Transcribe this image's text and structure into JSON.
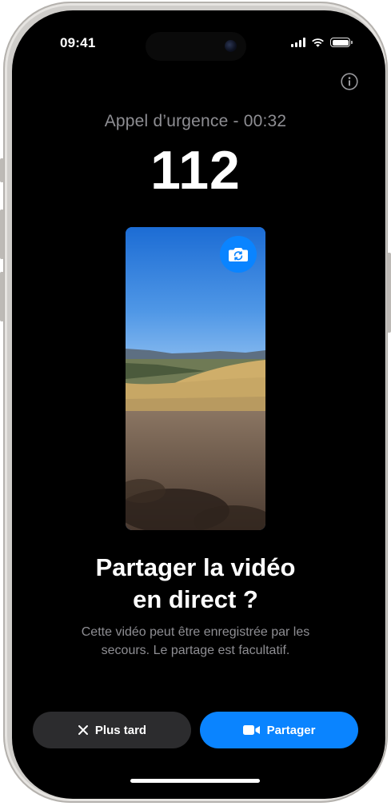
{
  "status_bar": {
    "time": "09:41",
    "icons": [
      "cellular-signal-icon",
      "wifi-icon",
      "battery-icon"
    ],
    "battery_level": 1.0
  },
  "call": {
    "status": "Appel d’urgence - 00:32",
    "number": "112"
  },
  "icons": {
    "info": "info-icon",
    "camera_flip": "camera-flip-icon",
    "close": "close-icon",
    "video": "video-camera-icon"
  },
  "prompt": {
    "title_line1": "Partager la vidéo",
    "title_line2": "en direct ?",
    "body_line1": "Cette vidéo peut être enregistrée par les",
    "body_line2": "secours. Le partage est facultatif."
  },
  "actions": {
    "later_label": "Plus tard",
    "share_label": "Partager"
  },
  "colors": {
    "accent": "#0a84ff",
    "secondary_button": "#2c2c2e",
    "muted_text": "#8e8e93",
    "background": "#000000"
  }
}
